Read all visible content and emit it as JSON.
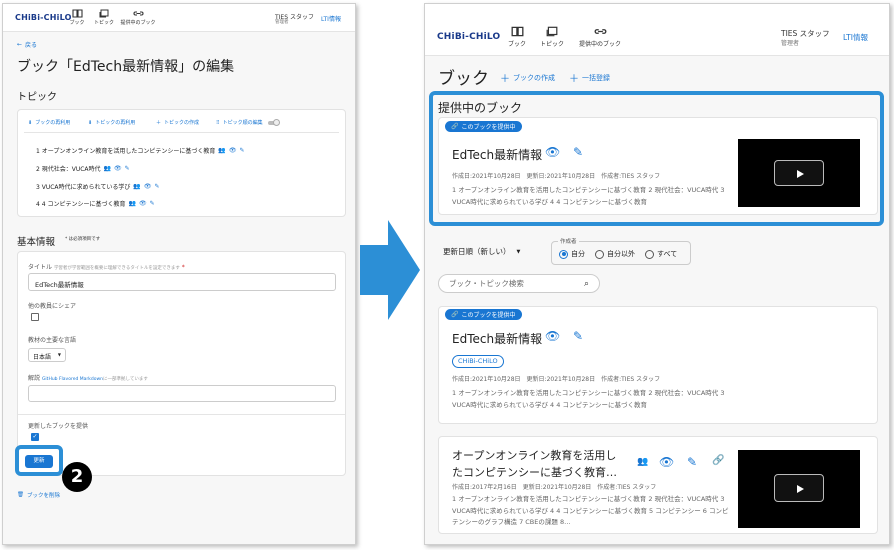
{
  "left": {
    "brand": "CHiBi-CHiLO",
    "nav": [
      {
        "label": "ブック"
      },
      {
        "label": "トピック"
      },
      {
        "label": "提供中のブック"
      }
    ],
    "user_name": "TIES スタッフ",
    "user_role": "管理者",
    "lti": "LTI情報",
    "back": "戻る",
    "page_title": "ブック「EdTech最新情報」の編集",
    "topic_heading": "トピック",
    "toolbar": {
      "reuse_book": "ブックの再利用",
      "reuse_topic": "トピックの再利用",
      "create_topic": "トピックの作成",
      "edit_order": "トピック順の編集"
    },
    "topics": [
      "1 オープンオンライン教育を活用したコンピテンシーに基づく教育",
      "2 現代社会：VUCA時代",
      "3 VUCA時代に求められている学び",
      "4 4 コンピテンシーに基づく教育"
    ],
    "basic_heading": "基本情報",
    "required_note": "* は必須項目です",
    "title_label": "タイトル",
    "title_hint": "学習者が学習範囲を概要に理解できるタイトルを設定できます",
    "title_value": "EdTech最新情報",
    "share_label": "他の教員にシェア",
    "lang_label": "教材の主要な言語",
    "lang_value": "日本語",
    "desc_label": "解説",
    "desc_link": "GitHub Flavored Markdown",
    "desc_hint": "に一部準拠しています",
    "provide_label": "更新したブックを提供",
    "update_button": "更新",
    "step_number": "2",
    "delete_book": "ブックを削除"
  },
  "right": {
    "brand": "CHiBi-CHiLO",
    "nav": [
      {
        "label": "ブック"
      },
      {
        "label": "トピック"
      },
      {
        "label": "提供中のブック"
      }
    ],
    "user_name": "TIES スタッフ",
    "user_role": "管理者",
    "lti": "LTI情報",
    "page_title": "ブック",
    "create_book": "ブックの作成",
    "bulk_register": "一括登録",
    "providing_heading": "提供中のブック",
    "provide_badge": "このブックを提供中",
    "featured": {
      "title": "EdTech最新情報",
      "meta": "作成日:2021年10月28日　更新日:2021年10月28日　作成者:TIES スタッフ",
      "desc": "1 オープンオンライン教育を活用したコンピテンシーに基づく教育 2 現代社会：VUCA時代 3 VUCA時代に求められている学び 4 4 コンピテンシーに基づく教育"
    },
    "sort_label": "更新日順（新しい）",
    "author_legend": "作成者",
    "author_options": [
      "自分",
      "自分以外",
      "すべて"
    ],
    "author_selected": "自分",
    "search_placeholder": "ブック・トピック検索",
    "list": [
      {
        "badge": "このブックを提供中",
        "title": "EdTech最新情報",
        "tag": "CHiBi-CHiLO",
        "meta": "作成日:2021年10月28日　更新日:2021年10月28日　作成者:TIES スタッフ",
        "desc": "1 オープンオンライン教育を活用したコンピテンシーに基づく教育 2 現代社会：VUCA時代 3 VUCA時代に求められている学び 4 4 コンピテンシーに基づく教育"
      },
      {
        "title_line1": "オープンオンライン教育を活用し",
        "title_line2": "たコンピテンシーに基づく教育…",
        "meta": "作成日:2017年2月16日　更新日:2021年10月28日　作成者:TIES スタッフ",
        "desc": "1 オープンオンライン教育を活用したコンピテンシーに基づく教育 2 現代社会：VUCA時代 3 VUCA時代に求められている学び 4 4 コンピテンシーに基づく教育 5 コンピテンシー 6 コンピテンシーのグラフ構造 7 CBEの課題 8…"
      }
    ]
  },
  "colors": {
    "accent": "#1976d2",
    "highlight": "#2c8fd6",
    "brand": "#1a3a8a"
  }
}
